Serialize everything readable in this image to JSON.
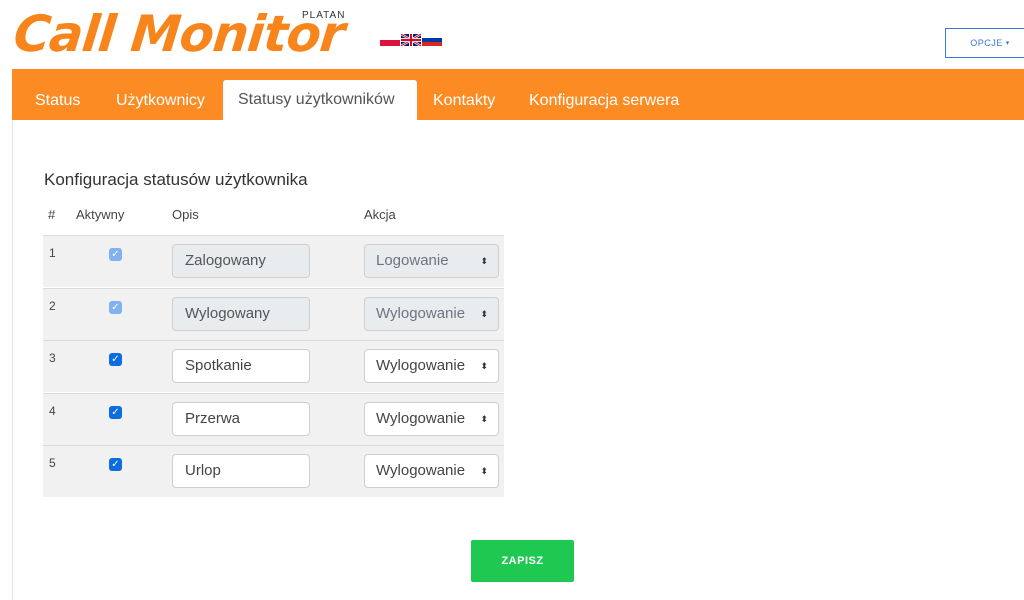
{
  "header": {
    "logo_text": "Call Monitor",
    "logo_sub": "PLATAN",
    "options_label": "OPCJE",
    "options_caret": "▾"
  },
  "nav": {
    "tabs": [
      {
        "label": "Status",
        "active": false
      },
      {
        "label": "Użytkownicy",
        "active": false
      },
      {
        "label": "Statusy użytkowników",
        "active": true
      },
      {
        "label": "Kontakty",
        "active": false
      },
      {
        "label": "Konfiguracja serwera",
        "active": false
      }
    ]
  },
  "section": {
    "title": "Konfiguracja statusów użytkownika",
    "columns": [
      "#",
      "Aktywny",
      "Opis",
      "Akcja"
    ]
  },
  "rows": [
    {
      "num": "1",
      "checked": true,
      "disabled": true,
      "opis": "Zalogowany",
      "akcja": "Logowanie"
    },
    {
      "num": "2",
      "checked": true,
      "disabled": true,
      "opis": "Wylogowany",
      "akcja": "Wylogowanie"
    },
    {
      "num": "3",
      "checked": true,
      "disabled": false,
      "opis": "Spotkanie",
      "akcja": "Wylogowanie"
    },
    {
      "num": "4",
      "checked": true,
      "disabled": false,
      "opis": "Przerwa",
      "akcja": "Wylogowanie"
    },
    {
      "num": "5",
      "checked": true,
      "disabled": false,
      "opis": "Urlop",
      "akcja": "Wylogowanie"
    }
  ],
  "icons": {
    "check": "✓",
    "select_arrows": "⬍"
  },
  "save_label": "ZAPISZ",
  "colors": {
    "brand_orange": "#fb8b22",
    "checkbox_blue": "#0b6de0",
    "save_green": "#1ec851",
    "options_blue": "#3a78d6"
  }
}
